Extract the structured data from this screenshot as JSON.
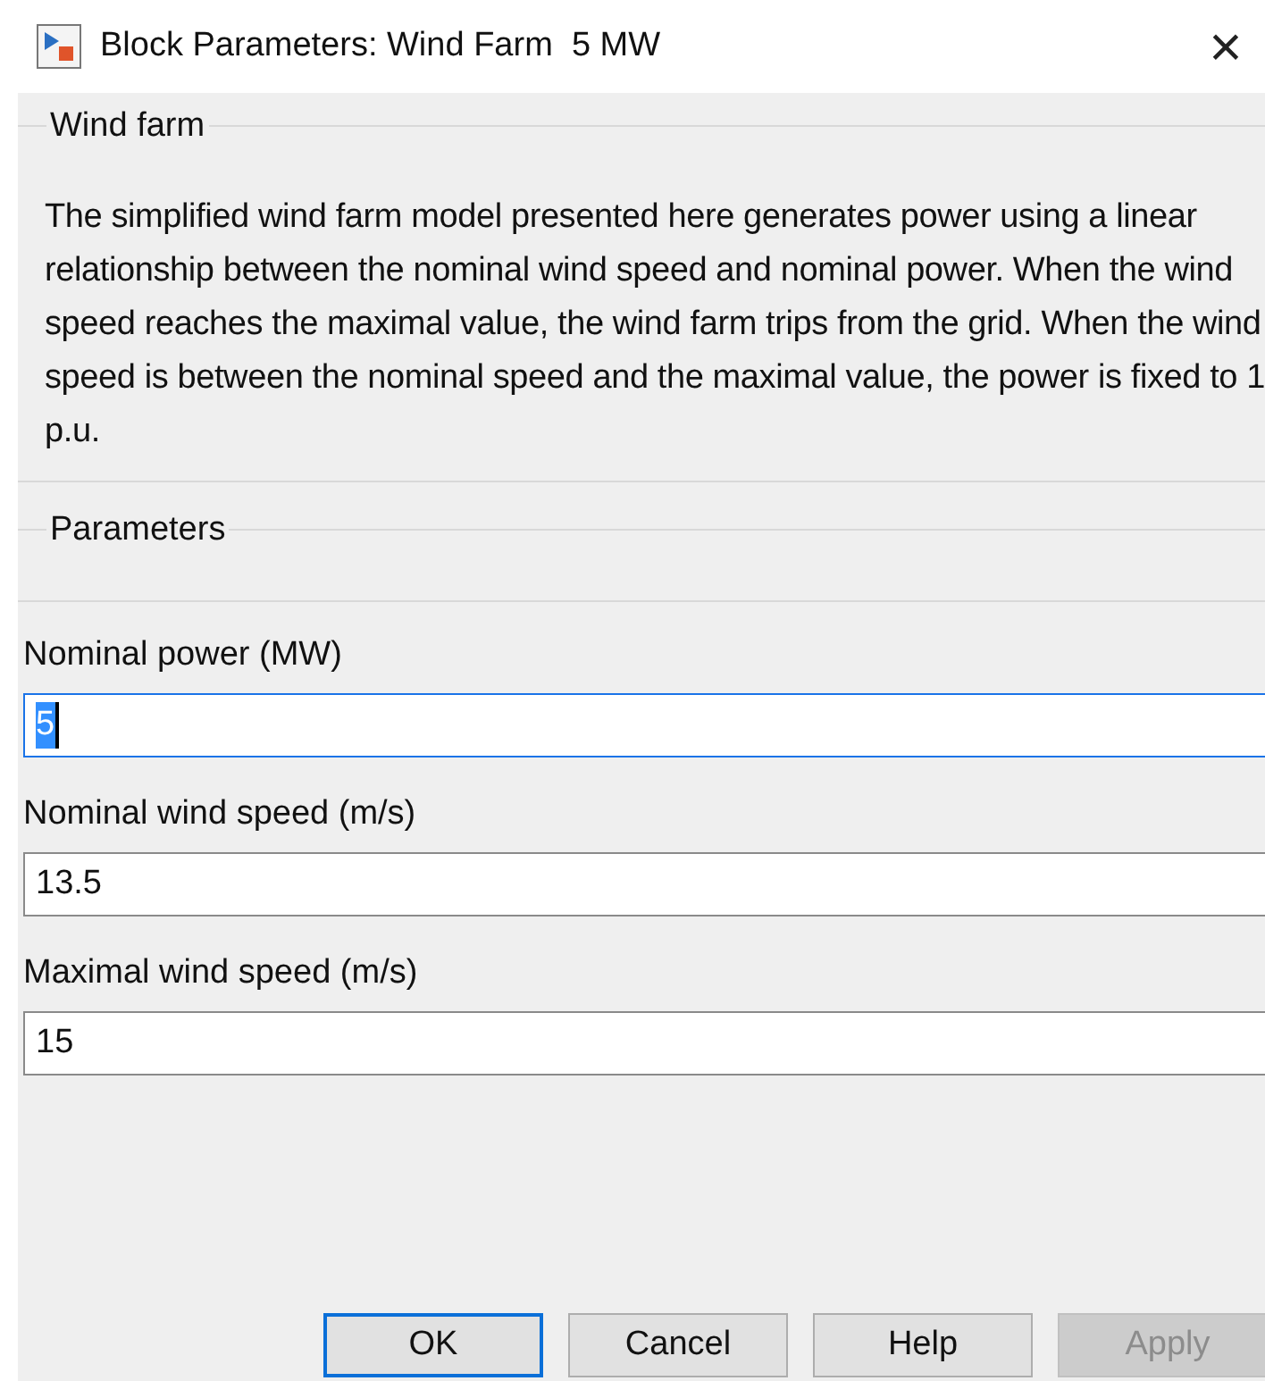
{
  "window": {
    "title": "Block Parameters: Wind Farm  5 MW",
    "close": "×"
  },
  "description_group": {
    "title": "Wind farm",
    "text": "The simplified wind farm model presented here generates power using a linear relationship between the nominal wind speed and nominal power. When the wind speed reaches the maximal value, the wind farm trips from the grid. When the wind speed is between the nominal speed and the maximal value, the power is fixed to 1 p.u."
  },
  "parameters_group": {
    "title": "Parameters"
  },
  "fields": [
    {
      "label": "Nominal power (MW)",
      "value": "5",
      "focused": true
    },
    {
      "label": "Nominal wind speed (m/s)",
      "value": "13.5",
      "focused": false
    },
    {
      "label": "Maximal wind speed (m/s)",
      "value": "15",
      "focused": false
    }
  ],
  "buttons": [
    {
      "label": "OK",
      "default": true,
      "disabled": false
    },
    {
      "label": "Cancel",
      "default": false,
      "disabled": false
    },
    {
      "label": "Help",
      "default": false,
      "disabled": false
    },
    {
      "label": "Apply",
      "default": false,
      "disabled": true
    }
  ]
}
